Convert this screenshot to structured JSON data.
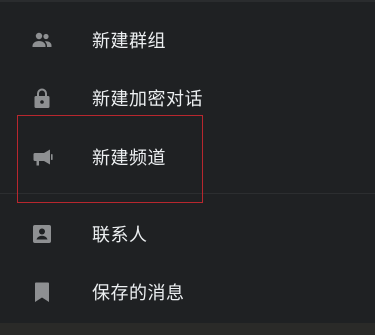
{
  "menu": {
    "items": [
      {
        "label": "新建群组",
        "icon": "group-icon"
      },
      {
        "label": "新建加密对话",
        "icon": "lock-icon"
      },
      {
        "label": "新建频道",
        "icon": "megaphone-icon"
      },
      {
        "label": "联系人",
        "icon": "contact-icon"
      },
      {
        "label": "保存的消息",
        "icon": "bookmark-icon"
      }
    ]
  },
  "colors": {
    "background": "#1f2123",
    "text": "#eceff1",
    "icon": "#8e9092",
    "highlight": "#b8272e"
  }
}
